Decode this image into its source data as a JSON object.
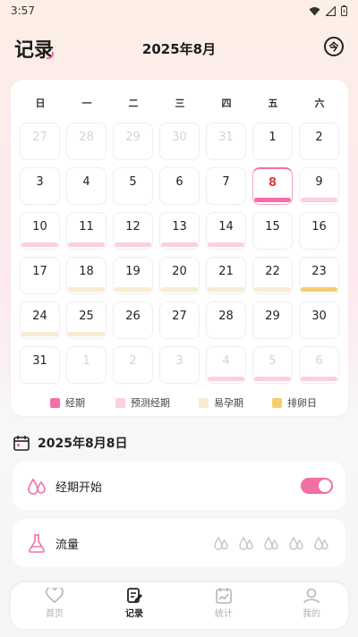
{
  "status": {
    "time": "3:57"
  },
  "header": {
    "brand": "记录",
    "month": "2025年8月",
    "today_btn": "今"
  },
  "weekdays": [
    "日",
    "一",
    "二",
    "三",
    "四",
    "五",
    "六"
  ],
  "calendar": [
    {
      "d": "27",
      "other": true,
      "bar": ""
    },
    {
      "d": "28",
      "other": true,
      "bar": ""
    },
    {
      "d": "29",
      "other": true,
      "bar": ""
    },
    {
      "d": "30",
      "other": true,
      "bar": ""
    },
    {
      "d": "31",
      "other": true,
      "bar": ""
    },
    {
      "d": "1",
      "other": false,
      "bar": ""
    },
    {
      "d": "2",
      "other": false,
      "bar": ""
    },
    {
      "d": "3",
      "other": false,
      "bar": ""
    },
    {
      "d": "4",
      "other": false,
      "bar": ""
    },
    {
      "d": "5",
      "other": false,
      "bar": ""
    },
    {
      "d": "6",
      "other": false,
      "bar": ""
    },
    {
      "d": "7",
      "other": false,
      "bar": ""
    },
    {
      "d": "8",
      "other": false,
      "bar": "period",
      "today": true
    },
    {
      "d": "9",
      "other": false,
      "bar": "predicted"
    },
    {
      "d": "10",
      "other": false,
      "bar": "predicted"
    },
    {
      "d": "11",
      "other": false,
      "bar": "predicted"
    },
    {
      "d": "12",
      "other": false,
      "bar": "predicted"
    },
    {
      "d": "13",
      "other": false,
      "bar": "predicted"
    },
    {
      "d": "14",
      "other": false,
      "bar": "predicted"
    },
    {
      "d": "15",
      "other": false,
      "bar": ""
    },
    {
      "d": "16",
      "other": false,
      "bar": ""
    },
    {
      "d": "17",
      "other": false,
      "bar": ""
    },
    {
      "d": "18",
      "other": false,
      "bar": "fertile"
    },
    {
      "d": "19",
      "other": false,
      "bar": "fertile"
    },
    {
      "d": "20",
      "other": false,
      "bar": "fertile"
    },
    {
      "d": "21",
      "other": false,
      "bar": "fertile"
    },
    {
      "d": "22",
      "other": false,
      "bar": "fertile"
    },
    {
      "d": "23",
      "other": false,
      "bar": "ovulation"
    },
    {
      "d": "24",
      "other": false,
      "bar": "fertile"
    },
    {
      "d": "25",
      "other": false,
      "bar": "fertile"
    },
    {
      "d": "26",
      "other": false,
      "bar": ""
    },
    {
      "d": "27",
      "other": false,
      "bar": ""
    },
    {
      "d": "28",
      "other": false,
      "bar": ""
    },
    {
      "d": "29",
      "other": false,
      "bar": ""
    },
    {
      "d": "30",
      "other": false,
      "bar": ""
    },
    {
      "d": "31",
      "other": false,
      "bar": ""
    },
    {
      "d": "1",
      "other": true,
      "bar": ""
    },
    {
      "d": "2",
      "other": true,
      "bar": ""
    },
    {
      "d": "3",
      "other": true,
      "bar": ""
    },
    {
      "d": "4",
      "other": true,
      "bar": "predicted"
    },
    {
      "d": "5",
      "other": true,
      "bar": "predicted"
    },
    {
      "d": "6",
      "other": true,
      "bar": "predicted"
    }
  ],
  "legend": [
    {
      "label": "经期",
      "color": "#f36fa6"
    },
    {
      "label": "预测经期",
      "color": "#fad0e2"
    },
    {
      "label": "易孕期",
      "color": "#f9ebcf"
    },
    {
      "label": "排卵日",
      "color": "#f5cc70"
    }
  ],
  "selected_date": "2025年8月8日",
  "cards": {
    "period_start": {
      "label": "经期开始",
      "on": true
    },
    "flow": {
      "label": "流量",
      "drops": 5
    }
  },
  "tabs": [
    {
      "label": "首页",
      "icon": "heart-icon",
      "active": false
    },
    {
      "label": "记录",
      "icon": "edit-icon",
      "active": true
    },
    {
      "label": "统计",
      "icon": "chart-icon",
      "active": false
    },
    {
      "label": "我的",
      "icon": "user-icon",
      "active": false
    }
  ],
  "colors": {
    "accent": "#f36fa6"
  }
}
